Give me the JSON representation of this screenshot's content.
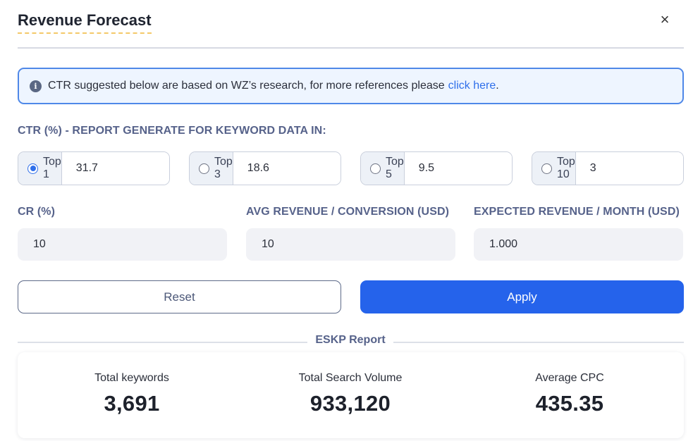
{
  "header": {
    "title": "Revenue Forecast",
    "close_symbol": "×"
  },
  "info": {
    "icon": "info-icon",
    "message": "CTR suggested below are based on WZ’s research, for more references please",
    "link_text": "click here",
    "link_suffix": "."
  },
  "ctr": {
    "label": "CTR (%) - REPORT GENERATE FOR KEYWORD DATA IN:",
    "options": [
      {
        "label": "Top 1",
        "value": "31.7",
        "selected": true
      },
      {
        "label": "Top 3",
        "value": "18.6",
        "selected": false
      },
      {
        "label": "Top 5",
        "value": "9.5",
        "selected": false
      },
      {
        "label": "Top 10",
        "value": "3",
        "selected": false
      }
    ]
  },
  "fields": {
    "cr": {
      "label": "CR (%)",
      "value": "10"
    },
    "avg_revenue": {
      "label": "AVG REVENUE / CONVERSION (USD)",
      "value": "10"
    },
    "expected_revenue": {
      "label": "EXPECTED REVENUE / MONTH (USD)",
      "value": "1.000"
    }
  },
  "buttons": {
    "reset_label": "Reset",
    "apply_label": "Apply"
  },
  "report": {
    "title": "ESKP Report",
    "stats": [
      {
        "label": "Total keywords",
        "value": "3,691"
      },
      {
        "label": "Total Search Volume",
        "value": "933,120"
      },
      {
        "label": "Average CPC",
        "value": "435.35"
      }
    ]
  },
  "colors": {
    "accent": "#2563eb",
    "info_border": "#4f88e8",
    "info_bg": "#eef5ff",
    "label": "#56628a",
    "title_underline": "#f3c969"
  }
}
